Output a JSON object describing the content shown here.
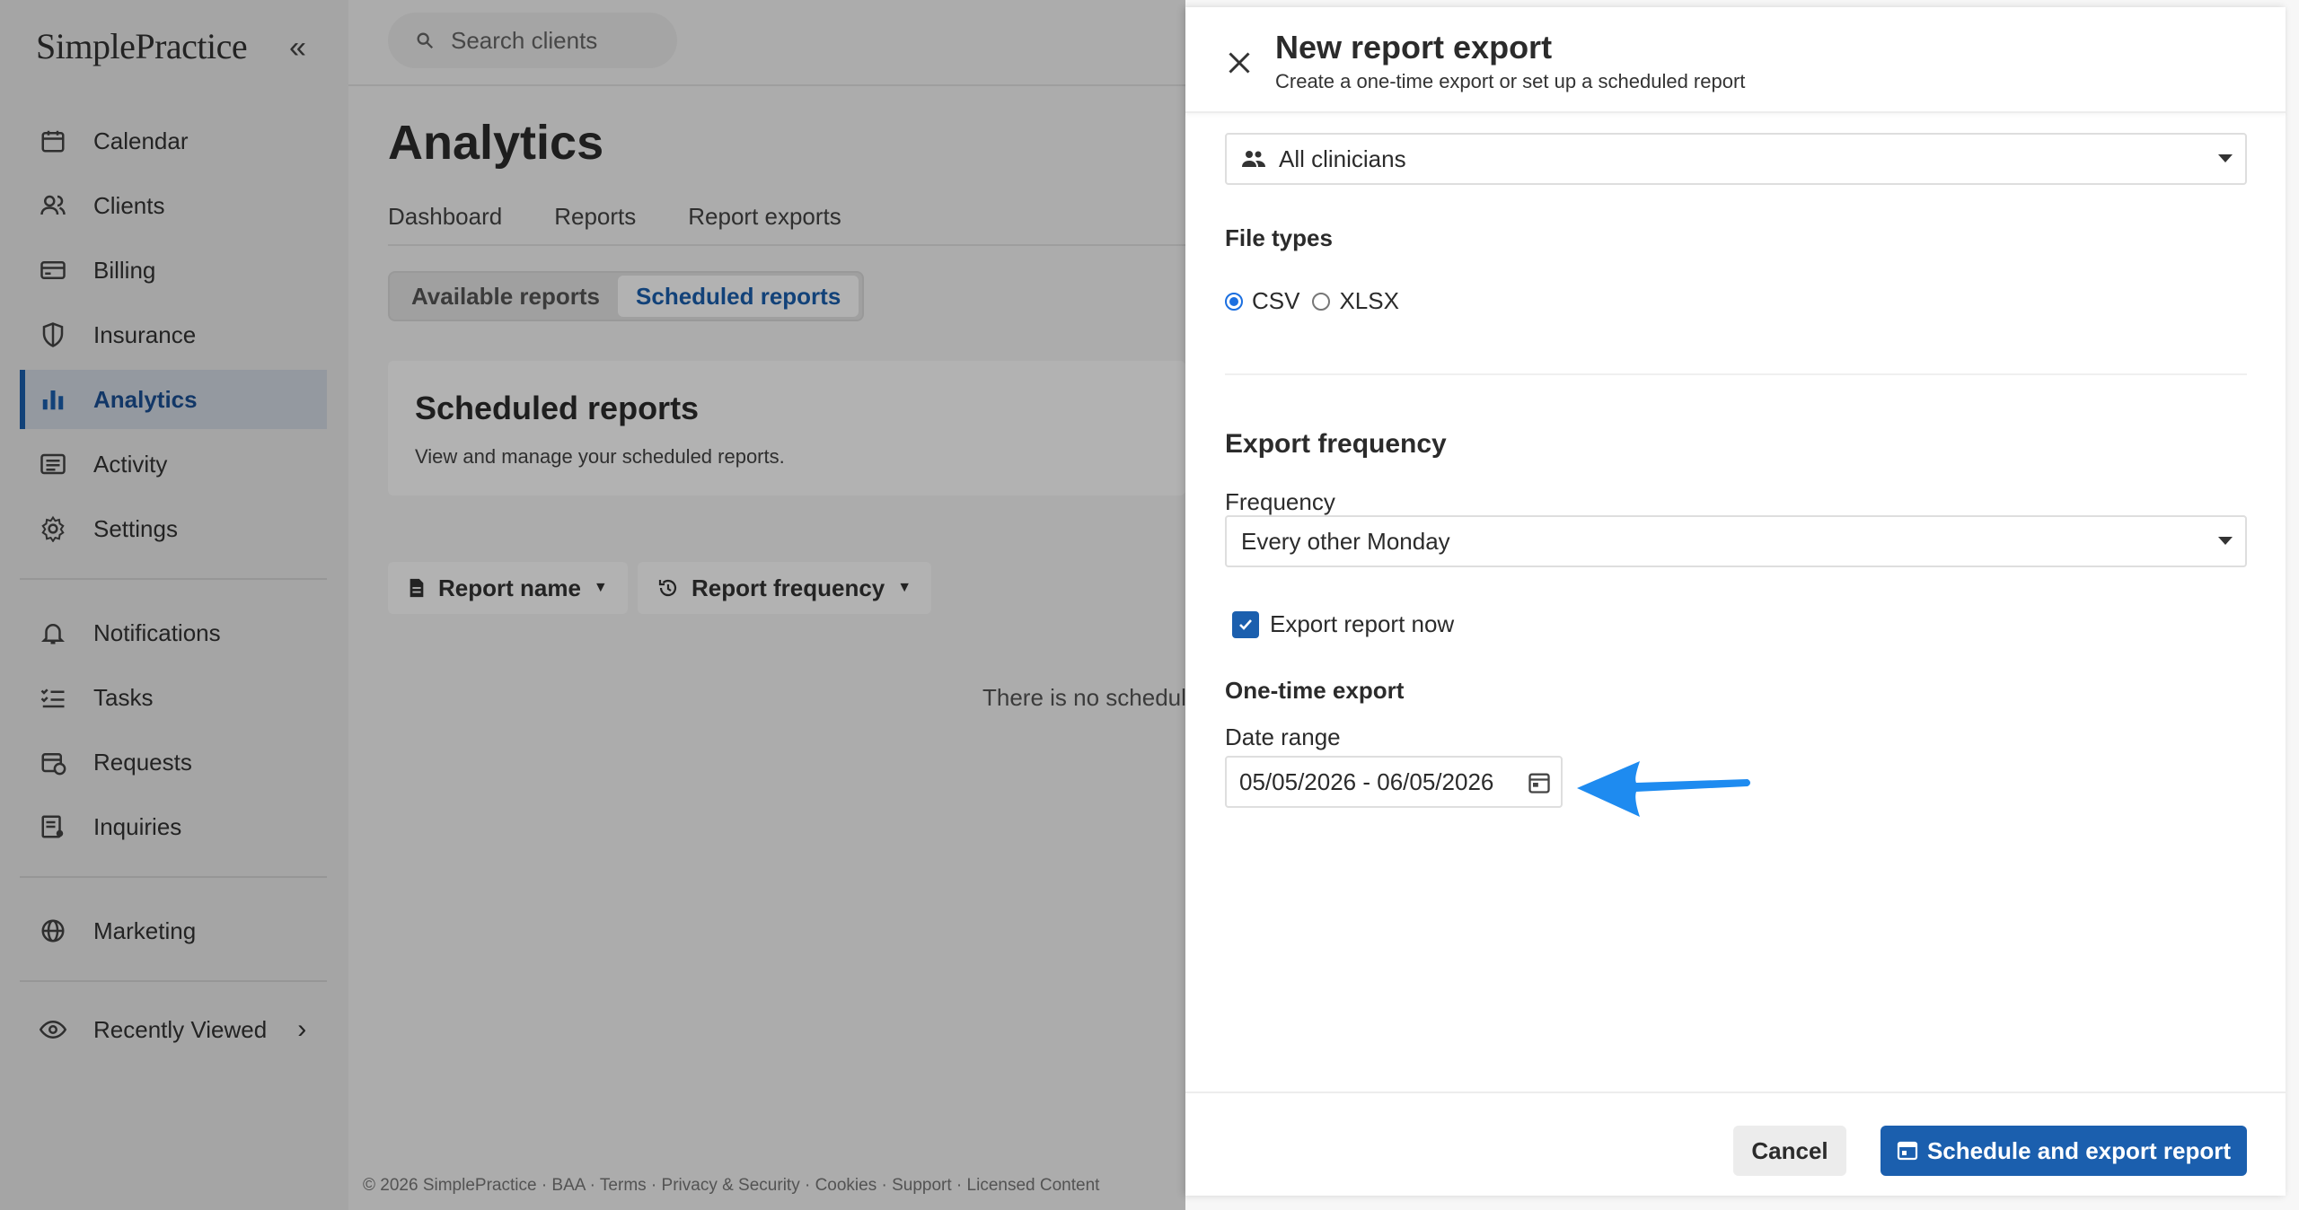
{
  "sidebar": {
    "logo": "SimplePractice",
    "items": [
      {
        "label": "Calendar",
        "icon": "calendar-icon"
      },
      {
        "label": "Clients",
        "icon": "clients-icon"
      },
      {
        "label": "Billing",
        "icon": "billing-icon"
      },
      {
        "label": "Insurance",
        "icon": "shield-icon"
      },
      {
        "label": "Analytics",
        "icon": "bar-chart-icon",
        "active": true
      },
      {
        "label": "Activity",
        "icon": "activity-list-icon"
      },
      {
        "label": "Settings",
        "icon": "gear-icon"
      },
      {
        "label": "Notifications",
        "icon": "bell-icon"
      },
      {
        "label": "Tasks",
        "icon": "tasks-icon"
      },
      {
        "label": "Requests",
        "icon": "requests-calendar-icon"
      },
      {
        "label": "Inquiries",
        "icon": "inquiries-icon"
      },
      {
        "label": "Marketing",
        "icon": "globe-icon"
      },
      {
        "label": "Recently Viewed",
        "icon": "eye-icon"
      }
    ]
  },
  "main": {
    "search_placeholder": "Search clients",
    "title": "Analytics",
    "tabs": [
      "Dashboard",
      "Reports",
      "Report exports"
    ],
    "segments": [
      "Available reports",
      "Scheduled reports"
    ],
    "card": {
      "title": "Scheduled reports",
      "subtitle": "View and manage your scheduled reports."
    },
    "filters": [
      "Report name",
      "Report frequency"
    ],
    "empty_text": "There is no schedul",
    "footer": "© 2026 SimplePractice · BAA · Terms · Privacy & Security · Cookies · Support · Licensed Content"
  },
  "panel": {
    "title": "New report export",
    "subtitle": "Create a one-time export or set up a scheduled report",
    "clinician_select": "All clinicians",
    "file_types_label": "File types",
    "file_types": [
      {
        "label": "CSV",
        "selected": true
      },
      {
        "label": "XLSX",
        "selected": false
      }
    ],
    "export_frequency_heading": "Export frequency",
    "frequency_label": "Frequency",
    "frequency_value": "Every other Monday",
    "export_now_label": "Export report now",
    "export_now_checked": true,
    "one_time_heading": "One-time export",
    "date_range_label": "Date range",
    "date_range_value": "05/05/2026 - 06/05/2026",
    "cancel_label": "Cancel",
    "primary_label": "Schedule and export report"
  },
  "colors": {
    "brand_blue": "#1b5fae",
    "annotation_arrow": "#1e8bf0",
    "sidebar_bg": "#ececec"
  }
}
